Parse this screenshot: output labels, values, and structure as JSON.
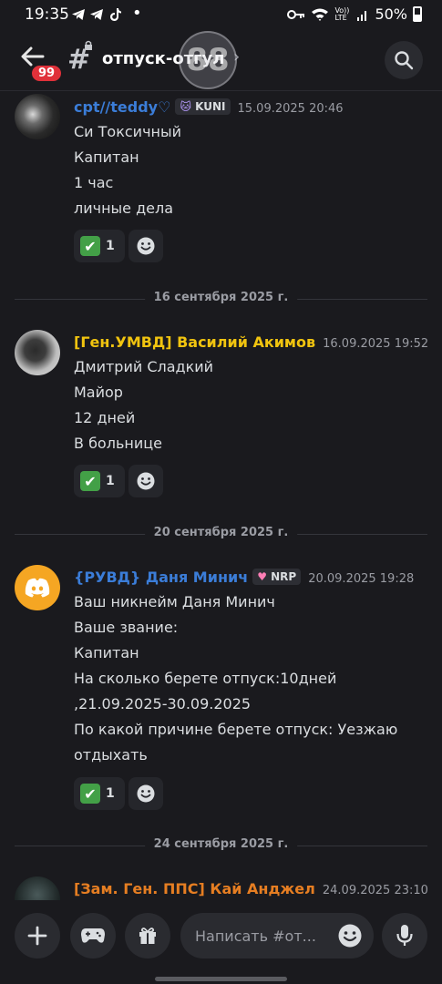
{
  "status_bar": {
    "time": "19:35",
    "battery": "50%",
    "net_label": "Vo)) LTE"
  },
  "header": {
    "unread_badge": "99",
    "channel_name": "отпуск-отгул",
    "watermark": "88"
  },
  "messages": [
    {
      "author": "cpt//teddy♡",
      "author_color": "#3b7dd8",
      "tag": "KUNI",
      "timestamp": "15.09.2025 20:46",
      "lines": [
        "Си Токсичный",
        "Капитан",
        "1 час",
        "личные дела"
      ],
      "reaction_emoji": "✔",
      "reaction_count": "1"
    },
    {
      "author": "[Ген.УМВД] Василий Акимов",
      "author_color": "#f1c40f",
      "timestamp": "16.09.2025 19:52",
      "lines": [
        "Дмитрий Сладкий",
        "Майор",
        "12 дней",
        "В больнице"
      ],
      "reaction_emoji": "✔",
      "reaction_count": "1"
    },
    {
      "author": "{РУВД} Даня Минич",
      "author_color": "#3b7dd8",
      "tag": "NRP",
      "timestamp": "20.09.2025 19:28",
      "lines": [
        "Ваш никнейм Даня Минич",
        "Ваше звание:",
        "Капитан",
        "На сколько берете отпуск:10дней",
        ",21.09.2025-30.09.2025",
        "По какой причине берете отпуск: Уезжаю",
        "отдыхать"
      ],
      "reaction_emoji": "✔",
      "reaction_count": "1"
    },
    {
      "author": "[Зам. Ген. ППС] Кай Анджел",
      "author_color": "#e67e22",
      "timestamp": "24.09.2025 23:10"
    }
  ],
  "separators": [
    "16 сентября 2025 г.",
    "20 сентября 2025 г.",
    "24 сентября 2025 г."
  ],
  "composer": {
    "placeholder": "Написать #от..."
  }
}
